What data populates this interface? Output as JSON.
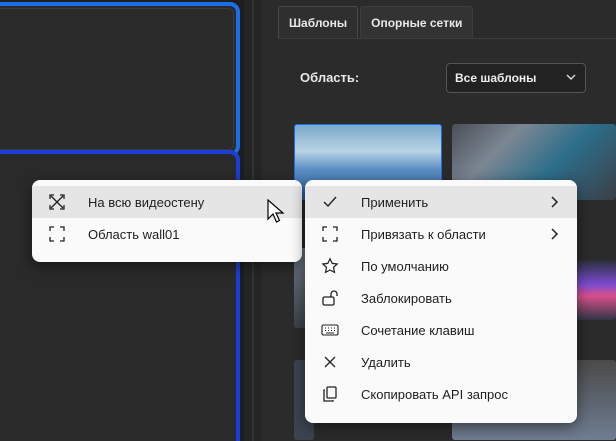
{
  "side_panel": {
    "tabs": [
      {
        "label": "Шаблоны",
        "active": true
      },
      {
        "label": "Опорные сетки",
        "active": false
      }
    ],
    "area_label": "Область:",
    "area_select_value": "Все шаблоны"
  },
  "submenu": {
    "items": [
      {
        "label": "На всю видеостену",
        "icon": "fullscreen-expand-icon",
        "hover": true
      },
      {
        "label": "Область wall01",
        "icon": "region-corners-icon",
        "hover": false
      }
    ]
  },
  "context_menu": {
    "items": [
      {
        "label": "Применить",
        "icon": "check-icon",
        "submenu": true,
        "hover": true
      },
      {
        "label": "Привязать к области",
        "icon": "region-corners-icon",
        "submenu": true
      },
      {
        "label": "По умолчанию",
        "icon": "star-icon",
        "submenu": false
      },
      {
        "label": "Заблокировать",
        "icon": "unlock-icon",
        "submenu": false
      },
      {
        "label": "Сочетание клавиш",
        "icon": "keyboard-icon",
        "submenu": false
      },
      {
        "label": "Удалить",
        "icon": "close-icon",
        "submenu": false
      },
      {
        "label": "Скопировать API запрос",
        "icon": "copy-icon",
        "submenu": false
      }
    ]
  },
  "colors": {
    "accent_blue": "#1a6fe8",
    "panel_bg": "#2b2b2b",
    "menu_bg": "#fafafa",
    "menu_hover": "#e5e5e5"
  }
}
